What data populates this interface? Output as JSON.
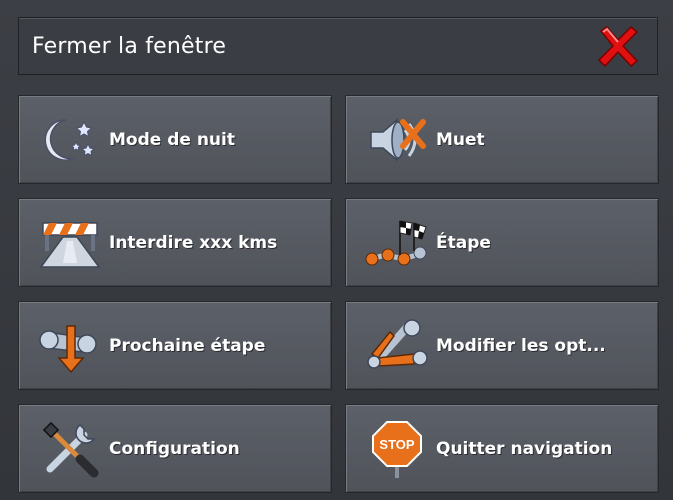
{
  "header": {
    "title": "Fermer la fenêtre",
    "close_icon": "red-x-icon",
    "close_color": "#e01010"
  },
  "buttons": [
    {
      "label": "Mode de nuit",
      "icon": "moon-stars-icon"
    },
    {
      "label": "Muet",
      "icon": "speaker-mute-icon"
    },
    {
      "label": "Interdire xxx kms",
      "icon": "road-barrier-icon"
    },
    {
      "label": "Étape",
      "icon": "waypoint-flags-icon"
    },
    {
      "label": "Prochaine étape",
      "icon": "next-waypoint-icon"
    },
    {
      "label": "Modifier les opt...",
      "icon": "route-options-icon"
    },
    {
      "label": "Configuration",
      "icon": "tools-icon"
    },
    {
      "label": "Quitter navigation",
      "icon": "stop-sign-icon"
    }
  ],
  "stop_sign_text": "STOP",
  "colors": {
    "background": "#35383e",
    "button": "#575a61",
    "accent_orange": "#e8701a"
  }
}
